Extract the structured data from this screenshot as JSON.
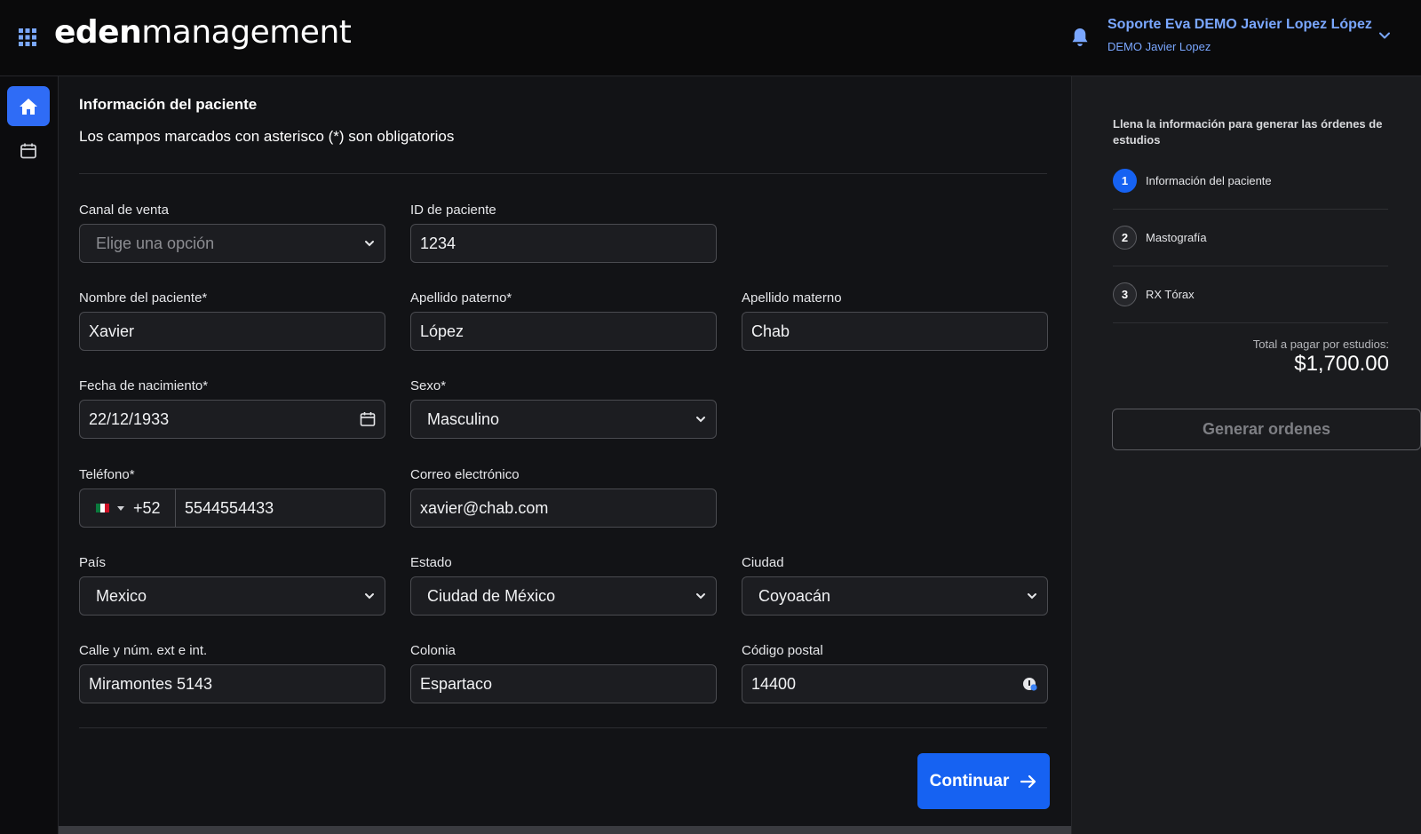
{
  "header": {
    "logo_bold": "eden",
    "logo_light": "management",
    "user_name": "Soporte Eva DEMO Javier Lopez López",
    "user_sub": "DEMO Javier Lopez"
  },
  "form": {
    "title": "Información del paciente",
    "subtitle": "Los campos marcados con asterisco (*) son obligatorios",
    "canal": {
      "label": "Canal de venta",
      "placeholder": "Elige una opción"
    },
    "id_paciente": {
      "label": "ID de paciente",
      "value": "1234"
    },
    "nombre": {
      "label": "Nombre del paciente*",
      "value": "Xavier"
    },
    "apellido_paterno": {
      "label": "Apellido paterno*",
      "value": "López"
    },
    "apellido_materno": {
      "label": "Apellido materno",
      "value": "Chab"
    },
    "fecha": {
      "label": "Fecha de nacimiento*",
      "value": "22/12/1933"
    },
    "sexo": {
      "label": "Sexo*",
      "value": "Masculino"
    },
    "telefono": {
      "label": "Teléfono*",
      "code": "+52",
      "value": "5544554433"
    },
    "correo": {
      "label": "Correo electrónico",
      "value": "xavier@chab.com"
    },
    "pais": {
      "label": "País",
      "value": "Mexico"
    },
    "estado": {
      "label": "Estado",
      "value": "Ciudad de México"
    },
    "ciudad": {
      "label": "Ciudad",
      "value": "Coyoacán"
    },
    "calle": {
      "label": "Calle y núm. ext e int.",
      "value": "Miramontes 5143"
    },
    "colonia": {
      "label": "Colonia",
      "value": "Espartaco"
    },
    "cp": {
      "label": "Código postal",
      "value": "14400"
    },
    "continue_label": "Continuar"
  },
  "sidebar": {
    "intro": "Llena la información para generar las órdenes de estudios",
    "steps": [
      {
        "num": "1",
        "label": "Información del paciente"
      },
      {
        "num": "2",
        "label": "Mastografía"
      },
      {
        "num": "3",
        "label": "RX Tórax"
      }
    ],
    "total_label": "Total a pagar por estudios:",
    "total_value": "$1,700.00",
    "generate_label": "Generar ordenes"
  },
  "colors": {
    "accent": "#1662f2",
    "user_link": "#7aa7ff",
    "background": "#121316"
  },
  "icons": [
    "apps-grid-icon",
    "bell-icon",
    "chevron-down-icon",
    "home-icon",
    "calendar-icon",
    "arrow-right-icon",
    "mexico-flag-icon",
    "info-icon"
  ]
}
